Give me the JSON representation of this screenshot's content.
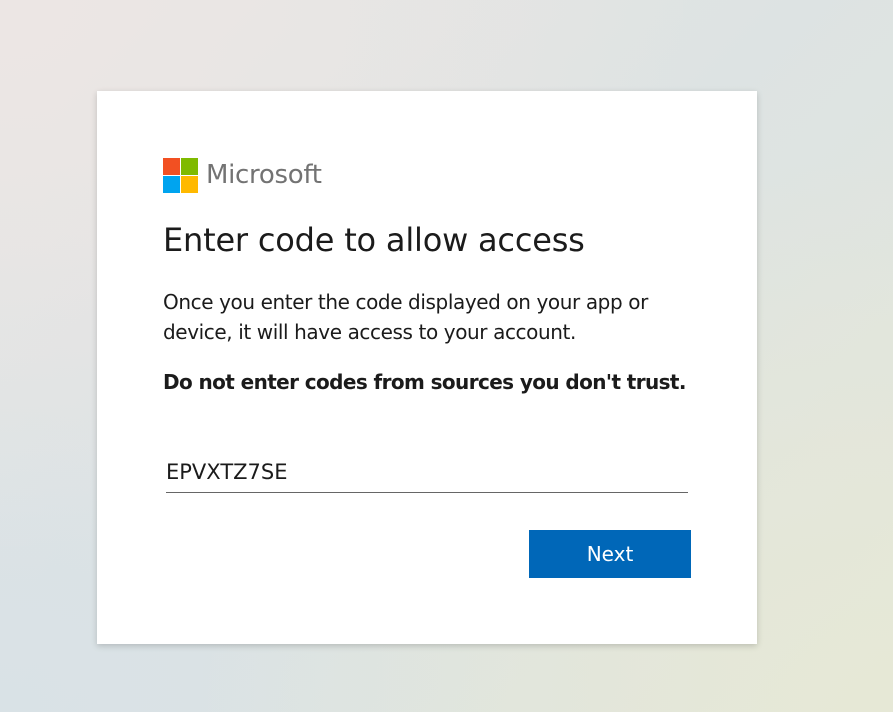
{
  "brand": {
    "name": "Microsoft",
    "logo_colors": {
      "top_left": "#f25022",
      "top_right": "#7fba00",
      "bottom_left": "#00a4ef",
      "bottom_right": "#ffb900"
    },
    "icon": "microsoft-logo-icon"
  },
  "dialog": {
    "title": "Enter code to allow access",
    "description": "Once you enter the code displayed on your app or device, it will have access to your account.",
    "warning": "Do not enter codes from sources you don't trust."
  },
  "code_input": {
    "value": "EPVXTZ7SE"
  },
  "next_button": {
    "label": "Next",
    "color": "#0067b8"
  }
}
